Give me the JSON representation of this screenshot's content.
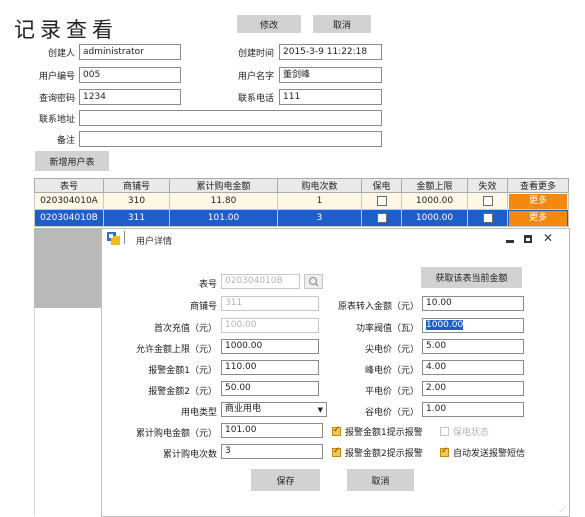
{
  "header": {
    "title": "记录查看",
    "edit_label": "修改",
    "cancel_label": "取消"
  },
  "form": {
    "creator_label": "创建人",
    "creator_value": "administrator",
    "created_time_label": "创建时间",
    "created_time_value": "2015-3-9 11:22:18",
    "user_no_label": "用户编号",
    "user_no_value": "005",
    "user_name_label": "用户名字",
    "user_name_value": "董剑峰",
    "query_pwd_label": "查询密码",
    "query_pwd_value": "1234",
    "phone_label": "联系电话",
    "phone_value": "111",
    "address_label": "联系地址",
    "address_value": "",
    "remark_label": "备注",
    "remark_value": ""
  },
  "add_user_table_label": "新增用户表",
  "table": {
    "columns": [
      "表号",
      "商铺号",
      "累计购电金额",
      "购电次数",
      "保电",
      "金额上限",
      "失效",
      "查看更多"
    ],
    "rows": [
      {
        "meter": "020304010A",
        "shop": "310",
        "total": "11.80",
        "count": "1",
        "limit": "1000.00",
        "more": "更多"
      },
      {
        "meter": "020304010B",
        "shop": "311",
        "total": "101.00",
        "count": "3",
        "limit": "1000.00",
        "more": "更多"
      }
    ]
  },
  "dialog": {
    "title": "用户详情",
    "meter_label": "表号",
    "meter_value": "020304010B",
    "get_amount_label": "获取该表当前金额",
    "shop_label": "商铺号",
    "shop_value": "311",
    "orig_amount_label": "原表转入金额（元）",
    "orig_amount_value": "10.00",
    "first_charge_label": "首次充值（元）",
    "first_charge_value": "100.00",
    "power_threshold_label": "功率阀值（瓦）",
    "power_threshold_value": "1000.00",
    "allowed_limit_label": "允许金额上限（元）",
    "allowed_limit_value": "1000.00",
    "peak_price_label": "尖电价（元）",
    "peak_price_value": "5.00",
    "alarm1_label": "报警金额1（元）",
    "alarm1_value": "110.00",
    "high_price_label": "峰电价（元）",
    "high_price_value": "4.00",
    "alarm2_label": "报警金额2（元）",
    "alarm2_value": "50.00",
    "flat_price_label": "平电价（元）",
    "flat_price_value": "2.00",
    "power_type_label": "用电类型",
    "power_type_value": "商业用电",
    "valley_price_label": "谷电价（元）",
    "valley_price_value": "1.00",
    "total_buy_label": "累计购电金额（元）",
    "total_buy_value": "101.00",
    "alarm1_prompt_label": "报警金额1提示报警",
    "keep_power_label": "保电状态",
    "buy_count_label": "累计购电次数",
    "buy_count_value": "3",
    "alarm2_prompt_label": "报警金额2提示报警",
    "auto_sms_label": "自动发送报警短信",
    "save_label": "保存",
    "cancel_label": "取消"
  },
  "colors": {
    "accent_orange": "#f5890f",
    "selected_row": "#1d5ec9",
    "button_gray": "#d2d2d2"
  }
}
